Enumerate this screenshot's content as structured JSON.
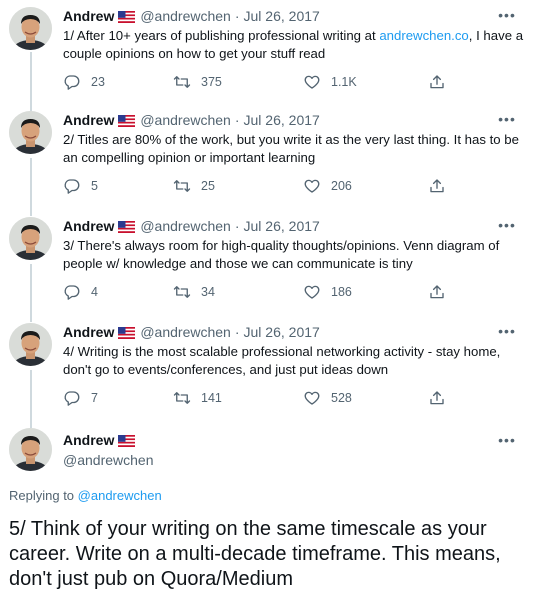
{
  "author": {
    "name": "Andrew",
    "handle": "@andrewchen"
  },
  "tweets": [
    {
      "date": "Jul 26, 2017",
      "text_before": "1/ After 10+ years of publishing professional writing at ",
      "link": "andrewchen.co",
      "text_after": ", I have a couple opinions on how to get your stuff read",
      "replies": "23",
      "retweets": "375",
      "likes": "1.1K"
    },
    {
      "date": "Jul 26, 2017",
      "text_before": "2/ Titles are 80% of the work, but you write it as the very last thing. It has to be an compelling opinion or important learning",
      "link": "",
      "text_after": "",
      "replies": "5",
      "retweets": "25",
      "likes": "206"
    },
    {
      "date": "Jul 26, 2017",
      "text_before": "3/ There's always room for high-quality thoughts/opinions. Venn diagram of people w/ knowledge and those we can communicate is tiny",
      "link": "",
      "text_after": "",
      "replies": "4",
      "retweets": "34",
      "likes": "186"
    },
    {
      "date": "Jul 26, 2017",
      "text_before": "4/ Writing is the most scalable professional networking activity - stay home, don't go to events/conferences, and just put ideas down",
      "link": "",
      "text_after": "",
      "replies": "7",
      "retweets": "141",
      "likes": "528"
    }
  ],
  "main_tweet": {
    "replying_prefix": "Replying to ",
    "replying_to": "@andrewchen",
    "text": "5/ Think of your writing on the same timescale as your career. Write on a multi-decade timeframe. This means, don't just pub on Quora/Medium"
  },
  "ui": {
    "separator": "·",
    "more_glyph": "•••"
  },
  "icons": {
    "reply": "reply-icon",
    "retweet": "retweet-icon",
    "like": "heart-icon",
    "share": "share-icon",
    "flag": "us-flag-icon",
    "more": "more-icon"
  },
  "colors": {
    "link": "#1d9bf0",
    "secondary_text": "#536471",
    "primary_text": "#0f1419",
    "thread_line": "#cfd9de"
  }
}
